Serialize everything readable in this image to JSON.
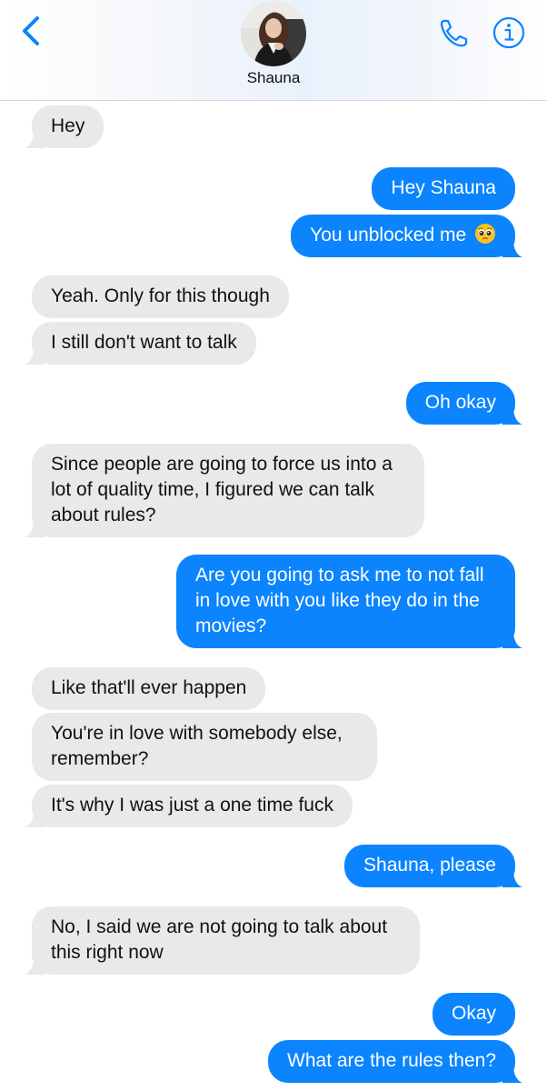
{
  "header": {
    "contact_name": "Shauna",
    "back_icon": "chevron-left-icon",
    "call_icon": "phone-icon",
    "info_icon": "info-icon"
  },
  "colors": {
    "accent": "#0b84fe",
    "incoming_bubble": "#e9e9eb"
  },
  "messages": [
    {
      "from": "them",
      "text": "Hey"
    },
    {
      "from": "me",
      "text": "Hey Shauna"
    },
    {
      "from": "me",
      "text": "You unblocked me",
      "emoji": "pleading-face-emoji"
    },
    {
      "from": "them",
      "text": "Yeah. Only for this though"
    },
    {
      "from": "them",
      "text": "I still don't want to talk"
    },
    {
      "from": "me",
      "text": "Oh okay"
    },
    {
      "from": "them",
      "text": "Since people are going to force us into a lot of quality time, I figured we can talk about rules?"
    },
    {
      "from": "me",
      "text": "Are you going to ask me to not fall in love with you like they do in the movies?"
    },
    {
      "from": "them",
      "text": "Like that'll ever happen"
    },
    {
      "from": "them",
      "text": "You're in love with somebody else, remember?"
    },
    {
      "from": "them",
      "text": "It's why I was just a one time fuck"
    },
    {
      "from": "me",
      "text": "Shauna, please"
    },
    {
      "from": "them",
      "text": "No, I said we are not going to talk about this right now"
    },
    {
      "from": "me",
      "text": "Okay"
    },
    {
      "from": "me",
      "text": "What are the rules then?"
    }
  ]
}
